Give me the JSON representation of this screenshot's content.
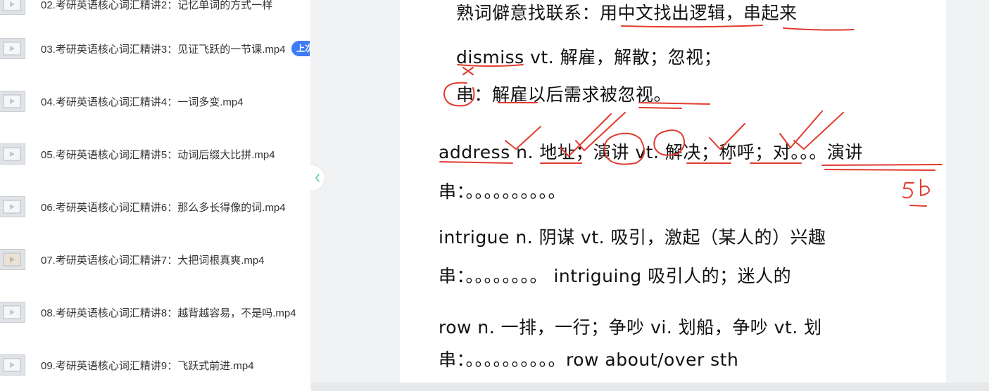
{
  "playlist": {
    "items": [
      {
        "title": "02.考研英语核心词汇精讲2：记忆单词的方式一样"
      },
      {
        "title": "03.考研英语核心词汇精讲3：见证飞跃的一节课.mp4",
        "badge": "上次"
      },
      {
        "title": "04.考研英语核心词汇精讲4：一词多变.mp4"
      },
      {
        "title": "05.考研英语核心词汇精讲5：动词后缀大比拼.mp4"
      },
      {
        "title": "06.考研英语核心词汇精讲6：那么多长得像的词.mp4"
      },
      {
        "title": "07.考研英语核心词汇精讲7：大把词根真爽.mp4"
      },
      {
        "title": "08.考研英语核心词汇精讲8：越背越容易，不是吗.mp4"
      },
      {
        "title": "09.考研英语核心词汇精讲9：飞跃式前进.mp4"
      }
    ]
  },
  "slide": {
    "lines": [
      "熟词僻意找联系：用中文找出逻辑，串起来",
      "dismiss vt. 解雇，解散；忽视；",
      "串：解雇以后需求被忽视。",
      "address n. 地址；演讲 vt. 解决；称呼；对。。。演讲",
      "串：。。。。。。。。。。",
      "intrigue n. 阴谋  vt. 吸引，激起（某人的）兴趣",
      "串：。。。。。。。。 intriguing 吸引人的；迷人的",
      "row n. 一排，一行；争吵   vi. 划船，争吵 vt. 划",
      "串：。。。。。。。。。。row about/over sth"
    ],
    "annotation": "5b"
  },
  "colors": {
    "accent": "#3d7bf7",
    "ink": "#e23b2e"
  },
  "icons": {
    "collapse": "chevron-left-icon",
    "thumb": "play-icon"
  }
}
